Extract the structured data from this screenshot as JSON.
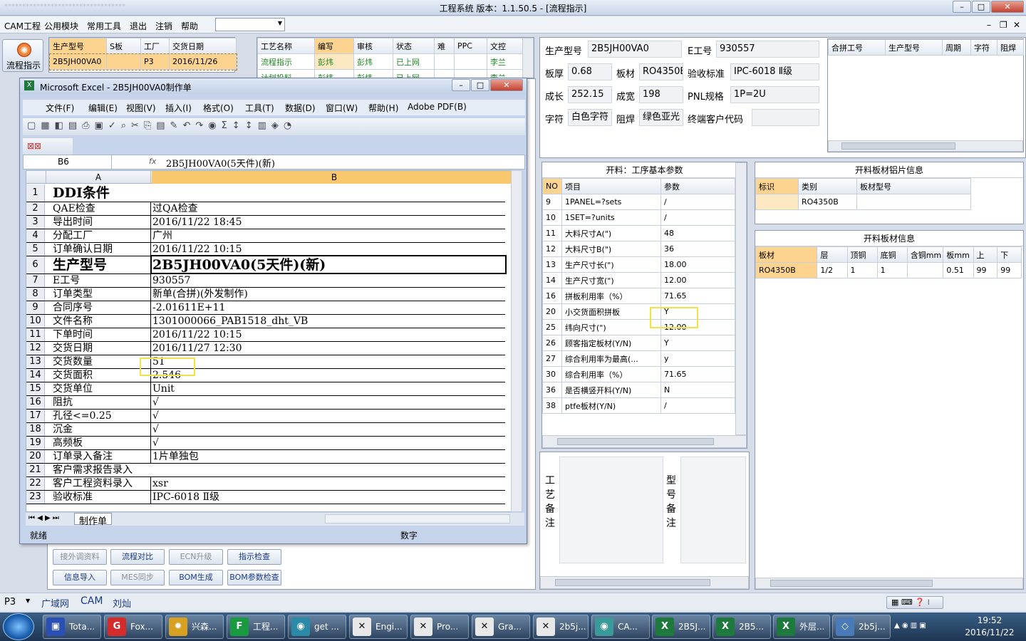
{
  "window": {
    "title": "工程系统   版本：1.1.50.5 - [流程指示]",
    "faded_text": "**********************************",
    "min": "–",
    "max": "□",
    "close": "✕"
  },
  "menu": {
    "items": [
      "CAM工程",
      "公用模块",
      "常用工具",
      "退出",
      "注销",
      "帮助"
    ],
    "combo": "",
    "controls": [
      "–",
      "❐",
      "✕"
    ]
  },
  "left": {
    "flow_button": "流程指示",
    "order_grid": {
      "headers": [
        "生产型号",
        "S板",
        "工厂",
        "交货日期"
      ],
      "rows": [
        [
          "2B5JH00VA0",
          "",
          "P3",
          "2016/11/26"
        ]
      ]
    },
    "process_grid": {
      "headers": [
        "工艺名称",
        "编写",
        "审核",
        "状态",
        "难",
        "PPC",
        "文控"
      ],
      "rows": [
        [
          "流程指示",
          "彭炜",
          "彭炜",
          "已上网",
          "",
          "",
          "李兰"
        ],
        [
          "计划投料",
          "彭炜",
          "彭炜",
          "已上网",
          "",
          "",
          "李兰"
        ]
      ]
    },
    "buttons": [
      [
        "接外调资料",
        "流程对比",
        "ECN升级",
        "指示检查"
      ],
      [
        "信息导入",
        "MES同步",
        "BOM生成",
        "BOM参数检查"
      ]
    ]
  },
  "excel": {
    "title": "Microsoft Excel - 2B5JH00VA0制作单",
    "menu": [
      "文件(F)",
      "编辑(E)",
      "视图(V)",
      "插入(I)",
      "格式(O)",
      "工具(T)",
      "数据(D)",
      "窗口(W)",
      "帮助(H)",
      "Adobe PDF(B)"
    ],
    "namebox": "B6",
    "fx": "fx",
    "formula": "2B5JH00VA0(5天件)(新)",
    "col_a": "A",
    "col_b": "B",
    "rows": [
      [
        "1",
        "DDI条件",
        ""
      ],
      [
        "2",
        "QAE检查",
        "过QA检查"
      ],
      [
        "3",
        "导出时间",
        "2016/11/22 18:45"
      ],
      [
        "4",
        "分配工厂",
        "广州"
      ],
      [
        "5",
        "订单确认日期",
        "2016/11/22 10:15"
      ],
      [
        "6",
        "生产型号",
        "2B5JH00VA0(5天件)(新)"
      ],
      [
        "7",
        "E工号",
        "930557"
      ],
      [
        "8",
        "订单类型",
        "新单(合拼)(外发制作)"
      ],
      [
        "9",
        "合同序号",
        "-2.01611E+11"
      ],
      [
        "10",
        "文件名称",
        "1301000066_PAB1518_dht_VB"
      ],
      [
        "11",
        "下单时间",
        "2016/11/22 10:15"
      ],
      [
        "12",
        "交货日期",
        "2016/11/27 12:30"
      ],
      [
        "13",
        "交货数量",
        "51"
      ],
      [
        "14",
        "交货面积",
        "2.546"
      ],
      [
        "15",
        "交货单位",
        "Unit"
      ],
      [
        "16",
        "阻抗",
        "√"
      ],
      [
        "17",
        "孔径<=0.25",
        "√"
      ],
      [
        "18",
        "沉金",
        "√"
      ],
      [
        "19",
        "高频板",
        "√"
      ],
      [
        "20",
        "订单录入备注",
        "1片单独包"
      ],
      [
        "21",
        "客户需求报告录入",
        ""
      ],
      [
        "22",
        "客户工程资料录入",
        "xsr"
      ],
      [
        "23",
        "验收标准",
        "IPC-6018 Ⅱ级"
      ]
    ],
    "sheet_tab": "制作单",
    "status": "就绪",
    "status_right": "数字"
  },
  "info": {
    "fields": [
      {
        "label": "生产型号",
        "value": "2B5JH00VA0"
      },
      {
        "label": "E工号",
        "value": "930557"
      },
      {
        "label": "板厚",
        "value": "0.68"
      },
      {
        "label": "板材",
        "value": "RO4350B"
      },
      {
        "label": "验收标准",
        "value": "IPC-6018 Ⅱ级"
      },
      {
        "label": "成长",
        "value": "252.15"
      },
      {
        "label": "成宽",
        "value": "198"
      },
      {
        "label": "PNL规格",
        "value": "1P=2U"
      },
      {
        "label": "字符",
        "value": "白色字符"
      },
      {
        "label": "阻焊",
        "value": "绿色亚光"
      },
      {
        "label": "终端客户代码",
        "value": ""
      }
    ],
    "merge_headers": [
      "合拼工号",
      "生产型号",
      "周期",
      "字符",
      "阻焊"
    ]
  },
  "params": {
    "title": "开料：工序基本参数",
    "headers": [
      "NO",
      "项目",
      "参数"
    ],
    "rows": [
      [
        "9",
        "1PANEL=?sets",
        "/"
      ],
      [
        "10",
        "1SET=?units",
        "/"
      ],
      [
        "11",
        "大料尺寸A(\")",
        "48"
      ],
      [
        "12",
        "大料尺寸B(\")",
        "36"
      ],
      [
        "13",
        "生产尺寸长(\")",
        "18.00"
      ],
      [
        "14",
        "生产尺寸宽(\")",
        "12.00"
      ],
      [
        "16",
        "拼板利用率（%）",
        "71.65"
      ],
      [
        "20",
        "小交货面积拼板",
        "Y"
      ],
      [
        "25",
        "纬向尺寸(\")",
        "12.00"
      ],
      [
        "26",
        "顾客指定板材(Y/N)",
        "Y"
      ],
      [
        "27",
        "综合利用率为最高(...",
        "y"
      ],
      [
        "30",
        "综合利用率（%）",
        "71.65"
      ],
      [
        "36",
        "是否横竖开料(Y/N)",
        "N"
      ],
      [
        "38",
        "ptfe板材(Y/N)",
        "/"
      ]
    ]
  },
  "sheet_info": {
    "title": "开料板材铝片信息",
    "headers": [
      "标识",
      "类别",
      "板材型号"
    ],
    "rows": [
      [
        "",
        "RO4350B",
        ""
      ]
    ]
  },
  "material_info": {
    "title": "开料板材信息",
    "headers": [
      "板材",
      "层",
      "顶铜",
      "底铜",
      "含铜mm",
      "板mm",
      "上",
      "下"
    ],
    "rows": [
      [
        "RO4350B",
        "1/2",
        "1",
        "1",
        "",
        "0.51",
        "99",
        "99"
      ]
    ]
  },
  "notes": {
    "left": [
      "工",
      "艺",
      "备",
      "注"
    ],
    "right": [
      "型",
      "号",
      "备",
      "注"
    ]
  },
  "statusbar": {
    "items": [
      "P3",
      "广域网",
      "CAM",
      "刘灿"
    ]
  },
  "taskbar": {
    "items": [
      {
        "label": "Tota...",
        "icon": "▣",
        "color": "#2a4fb5"
      },
      {
        "label": "Fox...",
        "icon": "G",
        "color": "#d62b2b"
      },
      {
        "label": "兴森...",
        "icon": "✹",
        "color": "#d8a020"
      },
      {
        "label": "工程...",
        "icon": "F",
        "color": "#1a9a40"
      },
      {
        "label": "get ...",
        "icon": "◉",
        "color": "#2a8aa8"
      },
      {
        "label": "Engi...",
        "icon": "✕",
        "color": "#e8e8e8"
      },
      {
        "label": "Pro...",
        "icon": "✕",
        "color": "#e8e8e8"
      },
      {
        "label": "Gra...",
        "icon": "✕",
        "color": "#e8e8e8"
      },
      {
        "label": "2b5j...",
        "icon": "✕",
        "color": "#e8e8e8"
      },
      {
        "label": "CA...",
        "icon": "◉",
        "color": "#3a9a9a"
      },
      {
        "label": "2B5J...",
        "icon": "X",
        "color": "#1e7a3c"
      },
      {
        "label": "2B5...",
        "icon": "X",
        "color": "#1e7a3c"
      },
      {
        "label": "外层...",
        "icon": "X",
        "color": "#1e7a3c"
      },
      {
        "label": "2b5j...",
        "icon": "◇",
        "color": "#4a7ab8"
      }
    ],
    "time": "19:52",
    "date": "2016/11/22"
  }
}
